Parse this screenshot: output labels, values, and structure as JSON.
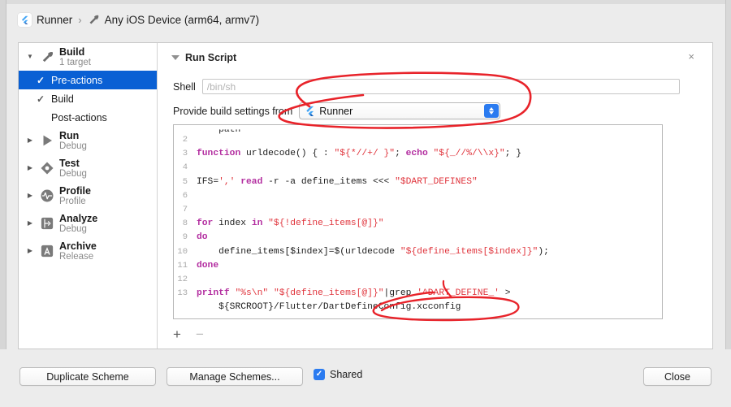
{
  "window": {
    "breadcrumb": {
      "scheme_name": "Runner",
      "separator": "›",
      "destination": "Any iOS Device (arm64, armv7)",
      "scheme_icon": "flutter-logo-icon",
      "destination_icon": "hammer-icon"
    }
  },
  "sidebar": {
    "groups": [
      {
        "name": "Build",
        "title": "Build",
        "subtitle": "1 target",
        "icon": "hammer-icon",
        "expanded": true,
        "disclosure": "▼",
        "children": [
          {
            "label": "Pre-actions",
            "checked": true,
            "check": "✓",
            "selected": true
          },
          {
            "label": "Build",
            "checked": true,
            "check": "✓",
            "selected": false
          },
          {
            "label": "Post-actions",
            "checked": false,
            "check": "",
            "selected": false
          }
        ]
      },
      {
        "name": "Run",
        "title": "Run",
        "subtitle": "Debug",
        "icon": "play-icon",
        "expanded": false,
        "disclosure": "▶",
        "children": []
      },
      {
        "name": "Test",
        "title": "Test",
        "subtitle": "Debug",
        "icon": "test-diamond-icon",
        "expanded": false,
        "disclosure": "▶",
        "children": []
      },
      {
        "name": "Profile",
        "title": "Profile",
        "subtitle": "Profile",
        "icon": "profile-waveform-icon",
        "expanded": false,
        "disclosure": "▶",
        "children": []
      },
      {
        "name": "Analyze",
        "title": "Analyze",
        "subtitle": "Debug",
        "icon": "analyze-icon",
        "expanded": false,
        "disclosure": "▶",
        "children": []
      },
      {
        "name": "Archive",
        "title": "Archive",
        "subtitle": "Release",
        "icon": "archive-icon",
        "expanded": false,
        "disclosure": "▶",
        "children": []
      }
    ]
  },
  "detail": {
    "header_title": "Run Script",
    "header_disclosure": "▼",
    "close_icon": "×",
    "shell": {
      "label": "Shell",
      "value": "",
      "placeholder": "/bin/sh"
    },
    "provide_build_settings": {
      "label": "Provide build settings from",
      "selected": "Runner",
      "icon": "flutter-logo-icon",
      "stepper_icon": "up-down-stepper-icon"
    },
    "editor": {
      "lines": [
        {
          "number": "",
          "text": "    path",
          "clipped": true
        },
        {
          "number": "2",
          "text": ""
        },
        {
          "number": "3",
          "text": "function urldecode() { : \"${*//+/ }\"; echo \"${_//%/\\\\x}\"; }"
        },
        {
          "number": "4",
          "text": ""
        },
        {
          "number": "5",
          "text": "IFS=',' read -r -a define_items <<< \"$DART_DEFINES\""
        },
        {
          "number": "6",
          "text": ""
        },
        {
          "number": "7",
          "text": ""
        },
        {
          "number": "8",
          "text": "for index in \"${!define_items[@]}\""
        },
        {
          "number": "9",
          "text": "do"
        },
        {
          "number": "10",
          "text": "    define_items[$index]=$(urldecode \"${define_items[$index]}\");"
        },
        {
          "number": "11",
          "text": "done"
        },
        {
          "number": "12",
          "text": ""
        },
        {
          "number": "13",
          "text": "printf \"%s\\n\" \"${define_items[@]}\"|grep '^DART_DEFINE_' >"
        },
        {
          "number": "",
          "text": "    ${SRCROOT}/Flutter/DartDefineConfig.xcconfig"
        }
      ]
    },
    "add_button": "+",
    "remove_button": "−"
  },
  "footer": {
    "duplicate_scheme": "Duplicate Scheme",
    "manage_schemes": "Manage Schemes...",
    "shared_label": "Shared",
    "shared_checked": true,
    "shared_check_glyph": "✓",
    "close": "Close"
  },
  "annotations": {
    "color": "#e8232a",
    "marks": [
      {
        "name": "circle-provide-build-settings",
        "shape": "hand-drawn-ellipse"
      },
      {
        "name": "circle-dartdefineconfig-path",
        "shape": "hand-drawn-ellipse"
      }
    ]
  },
  "colors": {
    "selection_blue": "#0a60d4",
    "accent_blue": "#2b7bf0",
    "annotation_red": "#e8232a",
    "keyword_magenta": "#b32ea0",
    "string_red": "#e0353d",
    "window_bg": "#ececec"
  }
}
